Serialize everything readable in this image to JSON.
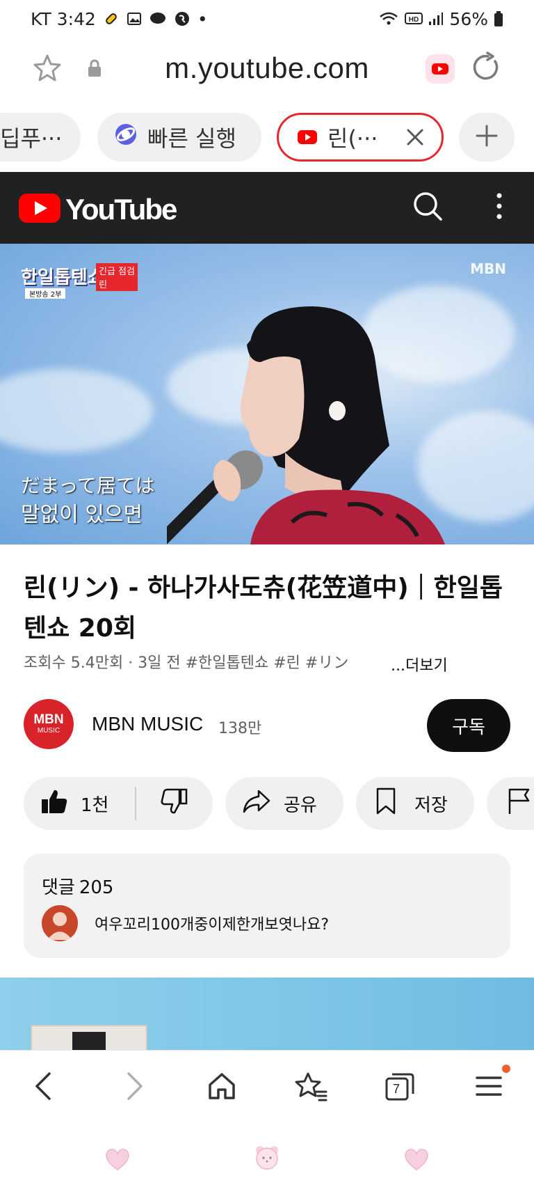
{
  "status_bar": {
    "carrier_time": "KT 3:42",
    "dot": "•",
    "battery": "56%"
  },
  "url_bar": {
    "url": "m.youtube.com"
  },
  "tabs": {
    "partial_tab_label": "딥푸···",
    "quick_tab_label": "빠른 실행",
    "active_tab_label": "린(···"
  },
  "youtube": {
    "logo_text": "YouTube"
  },
  "video": {
    "show_logo": "한일톱텐쇼",
    "badge": "긴급 점검",
    "badge_name": "린",
    "sub_badge": "본방송 2부",
    "watermark": "MBN",
    "subtitle_jp": "だまって居ては",
    "subtitle_kr": "말없이 있으면"
  },
  "info": {
    "title": "린(リン) - 하나가사도츄(花笠道中)｜한일톱텐쇼 20회",
    "meta": "조회수 5.4만회 · 3일 전  #한일톱텐쇼 #린 #リン",
    "more": "...더보기"
  },
  "channel": {
    "avatar_big": "MBN",
    "avatar_small": "MUSIC",
    "name": "MBN MUSIC",
    "subscribers": "138만",
    "subscribe_label": "구독"
  },
  "actions": {
    "like_count": "1천",
    "share_label": "공유",
    "save_label": "저장"
  },
  "comments": {
    "title": "댓글",
    "count": "205",
    "top_comment": "여우꼬리100개중이제한개보엿나요?"
  },
  "bottom_nav": {
    "tab_count": "7"
  },
  "colors": {
    "youtube_red": "#ff0000",
    "active_tab_border": "#e8262d",
    "header_bg": "#212121",
    "notification_dot": "#f0602a"
  }
}
